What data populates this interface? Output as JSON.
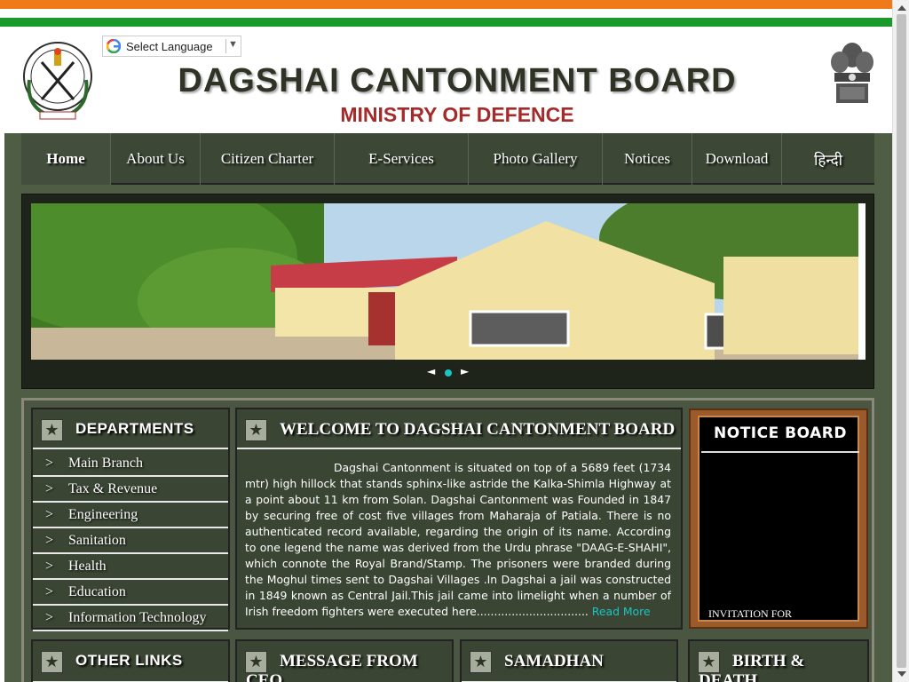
{
  "language_selector": {
    "label": "Select Language",
    "arrow": "▼",
    "icon": "google-g-icon"
  },
  "header": {
    "title": "DAGSHAI CANTONMENT BOARD",
    "subtitle": "MINISTRY OF DEFENCE",
    "left_emblem": {
      "top_text": "CANTONMENT BOARD",
      "middle_text": "DAGSHAI",
      "estd_label": "ESTD",
      "estd_year": "1847",
      "motto": "सेवा में निरन्तर"
    },
    "right_emblem": {
      "motto": "सत्यमेव जयते"
    }
  },
  "nav": {
    "items": [
      "Home",
      "About Us",
      "Citizen Charter",
      "E-Services",
      "Photo Gallery",
      "Notices",
      "Download",
      "हिन्दी"
    ]
  },
  "slider": {
    "prev": "◄",
    "next": "►"
  },
  "departments": {
    "title": "DEPARTMENTS",
    "chevron": ">",
    "items": [
      "Main Branch",
      "Tax & Revenue",
      "Engineering",
      "Sanitation",
      "Health",
      "Education",
      "Information Technology"
    ]
  },
  "welcome": {
    "title": "WELCOME TO DAGSHAI CANTONMENT BOARD",
    "body": "Dagshai Cantonment is situated on top of a 5689 feet (1734 mtr) high hillock that stands sphinx-like astride the Kalka-Shimla Highway at a point about 11 km from Solan. Dagshai Cantonment was Founded in 1847 by securing free of cost five villages from Maharaja of Patiala. There is no authenticated record available, regarding the origin of its name. According to one legend the name was derived from the Urdu phrase \"DAAG-E-SHAHI\", which connote the Royal Brand/Stamp. The prisoners were branded during the Moghul times sent to Dagshai Villages .In Dagshai a jail was constructed in 1849 known as Central Jail.This jail came into limelight when a number of Irish freedom fighters were executed here................................",
    "read_more": "Read More"
  },
  "notice_board": {
    "title": "NOTICE BOARD",
    "item": "INVITATION FOR"
  },
  "bottom_panels": {
    "other_links": "OTHER LINKS",
    "message_line1": "MESSAGE FROM",
    "message_line2": "CEO",
    "samadhan": "SAMADHAN",
    "birth_line1": "BIRTH &",
    "birth_line2": "DEATH"
  },
  "icons": {
    "panel_star": "★"
  },
  "colors": {
    "saffron": "#f07a1a",
    "green": "#1a9a2a",
    "olive_dark": "#3b4533",
    "subtitle_red": "#a52a2a",
    "link_cyan": "#19c6c6"
  }
}
